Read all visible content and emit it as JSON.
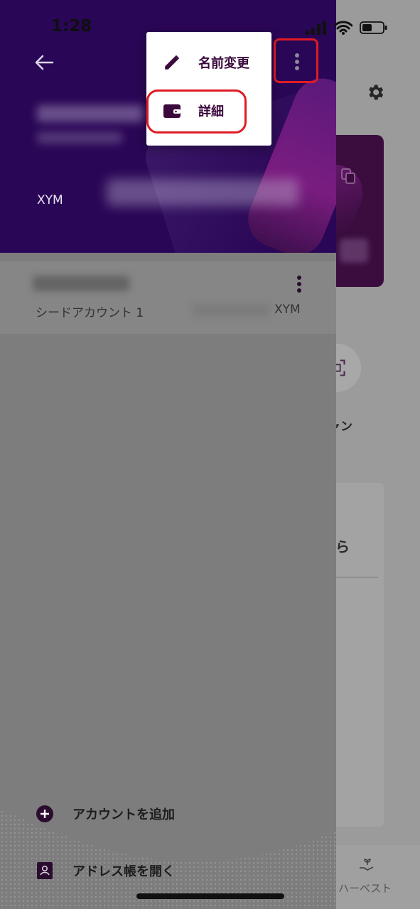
{
  "status_bar": {
    "time": "1:28"
  },
  "drawer": {
    "currency": "XYM",
    "accounts": [
      {
        "label": "シードアカウント 1",
        "currency": "XYM"
      }
    ],
    "actions": {
      "add_account": "アカウントを追加",
      "address_book": "アドレス帳を開く"
    }
  },
  "menu": {
    "rename": "名前変更",
    "details": "詳細"
  },
  "background": {
    "scan_label": "ャン",
    "panel_text": "ら",
    "harvest_label": "ハーベスト"
  },
  "colors": {
    "header_purple": "#2a0656",
    "menu_text": "#3b0a3d",
    "highlight_red": "#e01b24"
  }
}
